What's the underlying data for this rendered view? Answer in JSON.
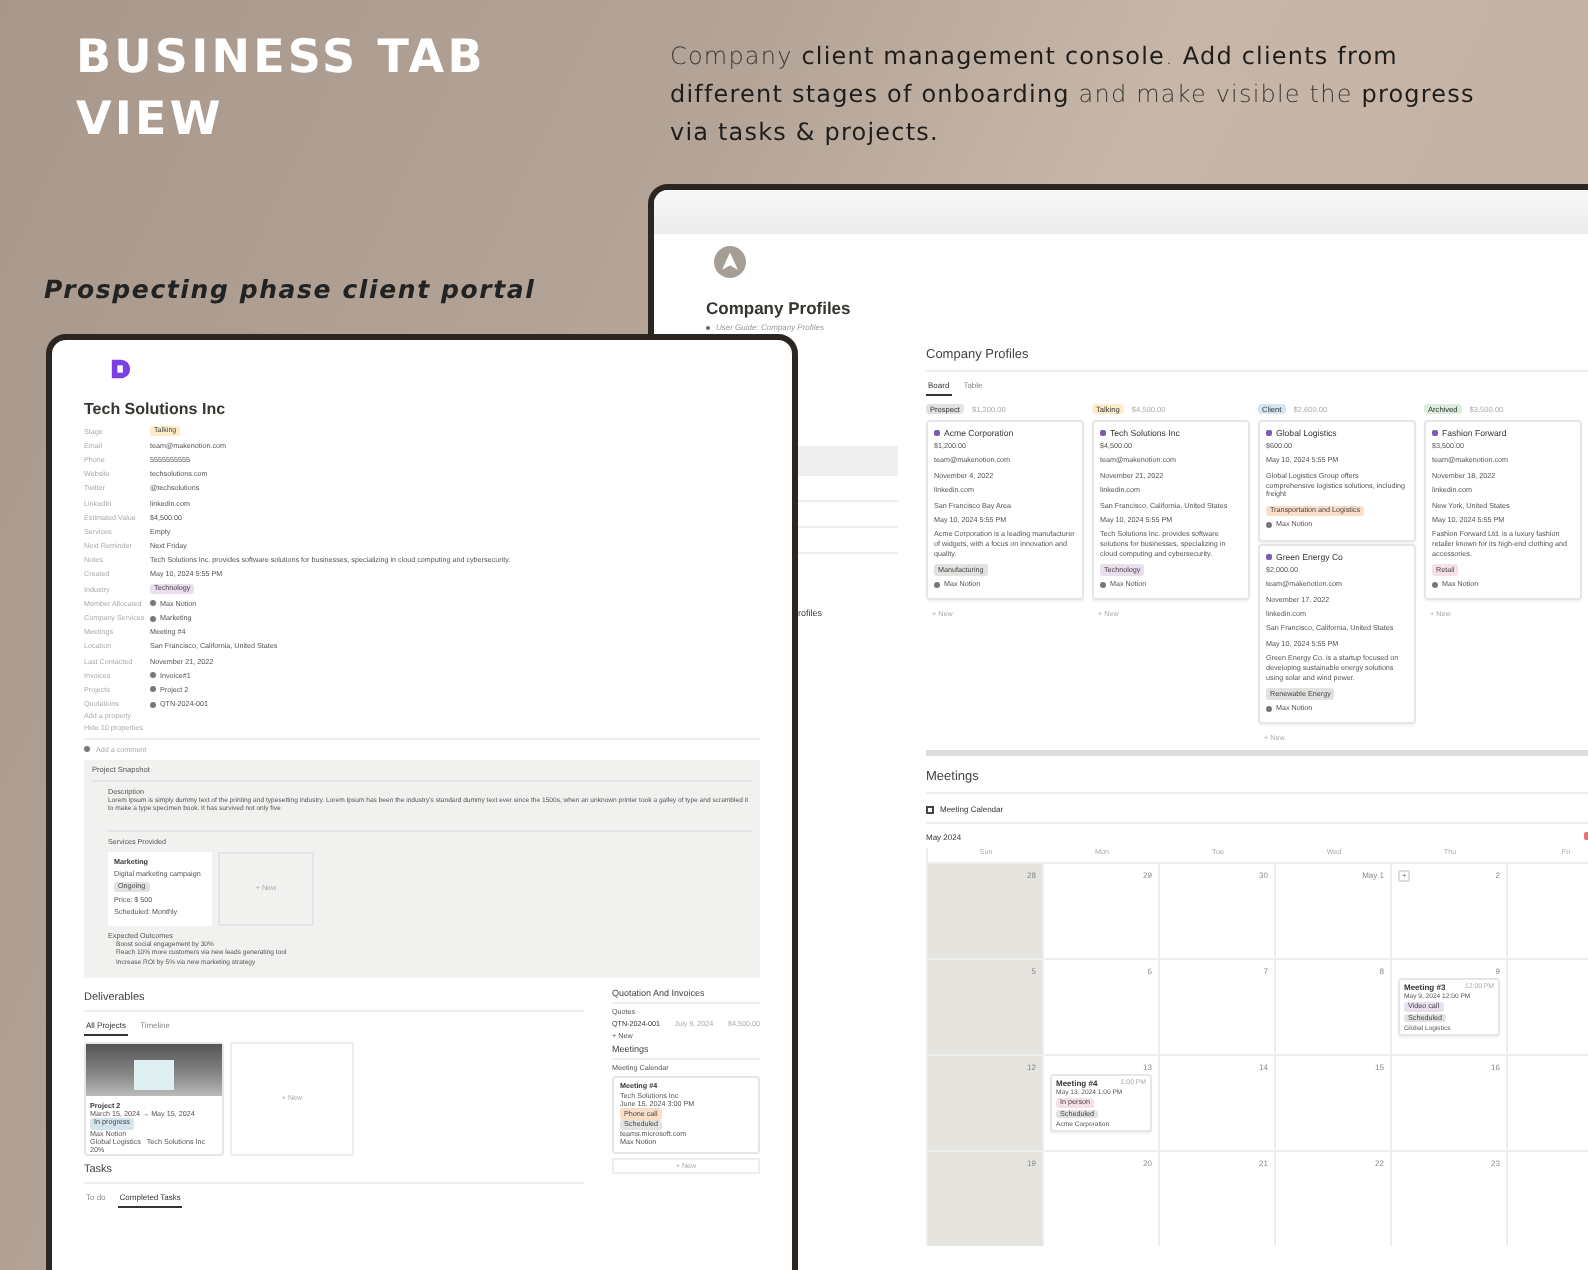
{
  "banner": {
    "title": "BUSINESS TAB VIEW",
    "tagline": "Company **client management console**. **Add clients from different stages of onboarding** and make visible the **progress via tasks & projects.**",
    "subtitle": "Prospecting phase client portal"
  },
  "profiles_window": {
    "title": "Company Profiles",
    "guide_link": "User Guide: Company Profiles",
    "side_fragment": "rofiles",
    "board": {
      "title": "Company Profiles",
      "views": [
        {
          "label": "Board",
          "selected": true
        },
        {
          "label": "Table",
          "selected": false
        }
      ],
      "columns": [
        {
          "status": "Prospect",
          "color": "#e3e2e0",
          "total": "$1,200.00",
          "cards": [
            {
              "name": "Acme Corporation",
              "lines": [
                "$1,200.00",
                "team@makenotion.com",
                "November 4, 2022",
                "linkedin.com",
                "San Francisco Bay Area",
                "May 10, 2024 5:55 PM",
                "Acme Corporation is a leading manufacturer of widgets, with a focus on innovation and quality."
              ],
              "tag": {
                "label": "Manufacturing",
                "color": "#e3e2e0"
              },
              "person": "Max Notion"
            }
          ],
          "add_label": "+ New"
        },
        {
          "status": "Talking",
          "color": "#fdecc8",
          "total": "$4,500.00",
          "cards": [
            {
              "name": "Tech Solutions Inc",
              "lines": [
                "$4,500.00",
                "team@makenotion.com",
                "November 21, 2022",
                "linkedin.com",
                "San Francisco, California, United States",
                "May 10, 2024 5:55 PM",
                "Tech Solutions Inc. provides software solutions for businesses, specializing in cloud computing and cybersecurity."
              ],
              "tag": {
                "label": "Technology",
                "color": "#e8deee"
              },
              "person": "Max Notion"
            }
          ],
          "add_label": "+ New"
        },
        {
          "status": "Client",
          "color": "#d3e5ef",
          "total": "$2,600.00",
          "cards": [
            {
              "name": "Global Logistics",
              "lines": [
                "$600.00",
                "May 10, 2024 5:55 PM",
                "Global Logistics Group offers comprehensive logistics solutions, including freight"
              ],
              "tag": {
                "label": "Transportation and Logistics",
                "color": "#fadec9"
              },
              "person": "Max Notion"
            },
            {
              "name": "Green Energy Co",
              "lines": [
                "$2,000.00",
                "team@makenotion.com",
                "November 17, 2022",
                "linkedin.com",
                "San Francisco, California, United States",
                "May 10, 2024 5:55 PM",
                "Green Energy Co. is a startup focused on developing sustainable energy solutions using solar and wind power."
              ],
              "tag": {
                "label": "Renewable Energy",
                "color": "#e3e2e0"
              },
              "person": "Max Notion"
            }
          ],
          "add_label": "+ New"
        },
        {
          "status": "Archived",
          "color": "#dbeddb",
          "total": "$3,500.00",
          "cards": [
            {
              "name": "Fashion Forward",
              "lines": [
                "$3,500.00",
                "team@makenotion.com",
                "November 18, 2022",
                "linkedin.com",
                "New York, United States",
                "May 10, 2024 5:55 PM",
                "Fashion Forward Ltd. is a luxury fashion retailer known for its high-end clothing and accessories."
              ],
              "tag": {
                "label": "Retail",
                "color": "#f5e0e9"
              },
              "person": "Max Notion"
            }
          ],
          "add_label": "+ New"
        }
      ]
    },
    "meetings": {
      "title": "Meetings",
      "view": "Meeting Calendar",
      "month": "May 2024",
      "weekdays": [
        {
          "label": "Sun",
          "weekend": true
        },
        {
          "label": "Mon",
          "weekend": false
        },
        {
          "label": "Tue",
          "weekend": false
        },
        {
          "label": "Wed",
          "weekend": false
        },
        {
          "label": "Thu",
          "weekend": false
        },
        {
          "label": "Fri",
          "weekend": false
        }
      ],
      "weeks": [
        {
          "days": [
            {
              "label": "28"
            },
            {
              "label": "29"
            },
            {
              "label": "30"
            },
            {
              "label": "May 1"
            },
            {
              "label": "2",
              "add_button": "+"
            }
          ]
        },
        {
          "days": [
            {
              "label": "5"
            },
            {
              "label": "6"
            },
            {
              "label": "7"
            },
            {
              "label": "8"
            },
            {
              "label": "9",
              "events": [
                {
                  "title": "Meeting #3",
                  "time": "12:00 PM",
                  "date": "May 9, 2024 12:00 PM",
                  "tags": [
                    {
                      "label": "Video call",
                      "color": "#e8deee"
                    },
                    {
                      "label": "Scheduled",
                      "color": "#e3e2e0"
                    }
                  ],
                  "company": "Global Logistics"
                }
              ]
            }
          ]
        },
        {
          "days": [
            {
              "label": "12"
            },
            {
              "label": "13",
              "events": [
                {
                  "title": "Meeting #4",
                  "time": "1:00 PM",
                  "date": "May 13, 2024 1:00 PM",
                  "tags": [
                    {
                      "label": "In person",
                      "color": "#f5e0e9"
                    },
                    {
                      "label": "Scheduled",
                      "color": "#e3e2e0"
                    }
                  ],
                  "company": "Acme Corporation"
                }
              ]
            },
            {
              "label": "14"
            },
            {
              "label": "15"
            },
            {
              "label": "16"
            }
          ]
        },
        {
          "days": [
            {
              "label": "19"
            },
            {
              "label": "20"
            },
            {
              "label": "21"
            },
            {
              "label": "22"
            },
            {
              "label": "23"
            }
          ]
        }
      ]
    }
  },
  "client_window": {
    "title": "Tech Solutions Inc",
    "properties": [
      {
        "label": "Stage",
        "kind": "tag",
        "value": "Talking",
        "color": "#fdecc8"
      },
      {
        "label": "Email",
        "kind": "text",
        "value": "team@makenotion.com"
      },
      {
        "label": "Phone",
        "kind": "text",
        "value": "5555555555"
      },
      {
        "label": "Website",
        "kind": "text",
        "value": "techsolutions.com"
      },
      {
        "label": "Twitter",
        "kind": "text",
        "value": "@techsolutions"
      },
      {
        "label": "LinkedIn",
        "kind": "text",
        "value": "linkedin.com"
      },
      {
        "label": "Estimated Value",
        "kind": "text",
        "value": "$4,500.00"
      },
      {
        "label": "Services",
        "kind": "empty",
        "value": "Empty"
      },
      {
        "label": "Next Reminder",
        "kind": "text",
        "value": "Next Friday"
      },
      {
        "label": "Notes",
        "kind": "text",
        "value": "Tech Solutions Inc. provides software solutions for businesses, specializing in cloud computing and cybersecurity."
      },
      {
        "label": "Created",
        "kind": "text",
        "value": "May 10, 2024 5:55 PM"
      },
      {
        "label": "Industry",
        "kind": "tag",
        "value": "Technology",
        "color": "#e8deee"
      },
      {
        "label": "Member Allocated",
        "kind": "page",
        "value": "Max Notion"
      },
      {
        "label": "Company Services",
        "kind": "page",
        "value": "Marketing"
      },
      {
        "label": "Meetings",
        "kind": "text",
        "value": "Meeting #4"
      },
      {
        "label": "Location",
        "kind": "text",
        "value": "San Francisco, California, United States"
      },
      {
        "label": "Last Contacted",
        "kind": "text",
        "value": "November 21, 2022"
      },
      {
        "label": "Invoices",
        "kind": "page",
        "value": "Invoice#1"
      },
      {
        "label": "Projects",
        "kind": "page",
        "value": "Project 2"
      },
      {
        "label": "Quotations",
        "kind": "page",
        "value": "QTN-2024-001"
      }
    ],
    "property_actions": [
      "Add a property",
      "Hide 10 properties"
    ],
    "comment": "Add a comment",
    "snapshot": {
      "title": "Project Snapshot",
      "description_label": "Description",
      "description": "Lorem Ipsum is simply dummy text of the printing and typesetting industry. Lorem Ipsum has been the industry's standard dummy text ever since the 1500s, when an unknown printer took a galley of type and scrambled it to make a type specimen book. It has survived not only five",
      "services_label": "Services Provided",
      "service": {
        "name": "Marketing",
        "description": "Digital marketing campaign",
        "status": "Ongoing",
        "details": [
          "Price: $ 500",
          "Scheduled: Monthly"
        ]
      },
      "add_label": "+ New",
      "outcomes_label": "Expected Outcomes",
      "outcomes": [
        "Boost social engagement by 30%",
        "Reach 10% more customers via new leads generating tool",
        "Increase ROI by 5% via new marketing strategy"
      ]
    },
    "deliverables": {
      "title": "Deliverables",
      "views": [
        {
          "label": "All Projects",
          "selected": true
        },
        {
          "label": "Timeline",
          "selected": false
        }
      ],
      "project": {
        "name": "Project 2",
        "dates": "March 15, 2024 → May 15, 2024",
        "status": "In progress",
        "person": "Max Notion",
        "companies": [
          "Global Logistics",
          "Tech Solutions Inc"
        ],
        "progress": "20%"
      },
      "add_label": "+ New"
    },
    "quotes": {
      "title": "Quotation And Invoices",
      "view": "Quotes",
      "item": {
        "name": "QTN-2024-001",
        "date": "July 9, 2024",
        "amount": "$4,500.00"
      },
      "add_label": "+ New"
    },
    "meetings": {
      "title": "Meetings",
      "view": "Meeting Calendar",
      "meeting": {
        "title": "Meeting #4",
        "company": "Tech Solutions Inc",
        "date": "June 15, 2024 3:00 PM",
        "tags": [
          {
            "label": "Phone call",
            "color": "#fadec9"
          },
          {
            "label": "Scheduled",
            "color": "#e3e2e0"
          }
        ],
        "link": "teams.microsoft.com",
        "person": "Max Notion"
      },
      "add_label": "+ New"
    },
    "tasks": {
      "title": "Tasks",
      "views": [
        {
          "label": "To do",
          "selected": false
        },
        {
          "label": "Completed Tasks",
          "selected": true
        }
      ]
    }
  }
}
